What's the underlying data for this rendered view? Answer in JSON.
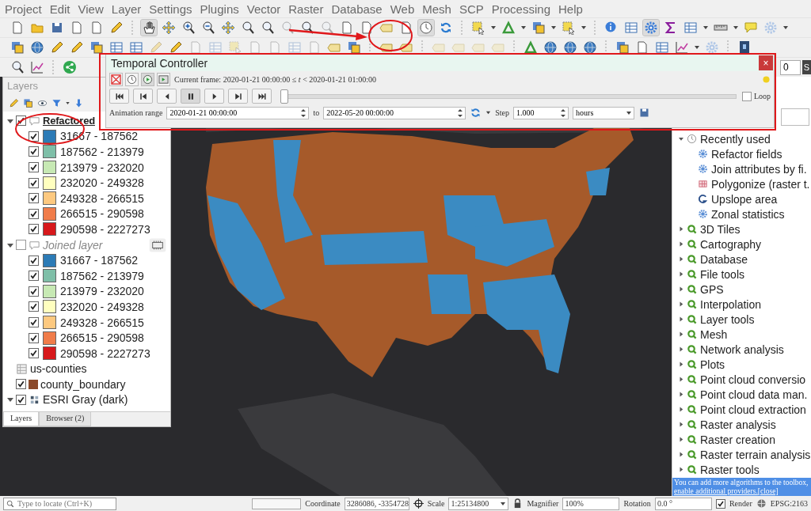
{
  "menu": [
    "Project",
    "Edit",
    "View",
    "Layer",
    "Settings",
    "Plugins",
    "Vector",
    "Raster",
    "Database",
    "Web",
    "Mesh",
    "SCP",
    "Processing",
    "Help"
  ],
  "toolbar_corner": {
    "spin_value": "0",
    "button": "S"
  },
  "temporal_controller": {
    "title": "Temporal Controller",
    "close": "×",
    "modes": [
      {
        "selected": false
      },
      {
        "selected": false
      },
      {
        "selected": true
      },
      {
        "selected": false
      }
    ],
    "current_frame": "Current frame: 2020-01-21 00:00:00 ≤ *t* < 2020-01-21 01:00:00",
    "playback": [
      {
        "selected": false
      },
      {
        "selected": false
      },
      {
        "selected": false
      },
      {
        "selected": true
      },
      {
        "selected": false
      },
      {
        "selected": false
      },
      {
        "selected": false
      }
    ],
    "slider": {
      "level": 0
    },
    "loop": {
      "label": "Loop",
      "checked": false
    },
    "range_label": "Animation range",
    "range_start": "2020-01-21 00:00:00",
    "to_label": "to",
    "range_end": "2022-05-20 00:00:00",
    "step_label": "Step",
    "step": "1.000",
    "unit": "hours"
  },
  "layers_panel": {
    "title": "Layers",
    "layers": [
      {
        "name": "Refactored",
        "kind": "vector",
        "checked": true,
        "expanded": true,
        "current": true,
        "legend": [
          {
            "label": "31667 - 187562",
            "color": "#2c7bb6",
            "checked": true
          },
          {
            "label": "187562 - 213979",
            "color": "#7fbfa8",
            "checked": true
          },
          {
            "label": "213979 - 232020",
            "color": "#c7e9b4",
            "checked": true
          },
          {
            "label": "232020 - 249328",
            "color": "#ffffbf",
            "checked": true
          },
          {
            "label": "249328 - 266515",
            "color": "#fdc980",
            "checked": true
          },
          {
            "label": "266515 - 290598",
            "color": "#f07c4a",
            "checked": true
          },
          {
            "label": "290598 - 2227273",
            "color": "#d7191c",
            "checked": true
          }
        ]
      },
      {
        "name": "Joined layer",
        "kind": "vector",
        "checked": false,
        "expanded": true,
        "current": false,
        "indicator": true,
        "legend": [
          {
            "label": "31667 - 187562",
            "color": "#2c7bb6",
            "checked": true
          },
          {
            "label": "187562 - 213979",
            "color": "#7fbfa8",
            "checked": true
          },
          {
            "label": "213979 - 232020",
            "color": "#c7e9b4",
            "checked": true
          },
          {
            "label": "232020 - 249328",
            "color": "#ffffbf",
            "checked": true
          },
          {
            "label": "249328 - 266515",
            "color": "#fdc980",
            "checked": true
          },
          {
            "label": "266515 - 290598",
            "color": "#f07c4a",
            "checked": true
          },
          {
            "label": "290598 - 2227273",
            "color": "#d7191c",
            "checked": true
          }
        ]
      },
      {
        "name": "us-counties",
        "kind": "table",
        "current": false
      },
      {
        "name": "county_boundary",
        "kind": "fill",
        "color": "#8b4a2b",
        "checked": true,
        "current": false
      },
      {
        "name": "ESRI Gray (dark)",
        "kind": "raster",
        "checked": true,
        "expanded": true,
        "current": false
      }
    ],
    "tabs": [
      {
        "label": "Layers",
        "selected": true
      },
      {
        "label": "Browser (2)",
        "selected": false
      }
    ]
  },
  "processing": {
    "groups": [
      {
        "label": "Recently used",
        "kind": "recent",
        "expanded": true,
        "children": [
          {
            "label": "Refactor fields",
            "kind": "gear"
          },
          {
            "label": "Join attributes by fi.",
            "kind": "gear"
          },
          {
            "label": "Polygonize (raster t.",
            "kind": "grid"
          },
          {
            "label": "Upslope area",
            "kind": "curve"
          },
          {
            "label": "Zonal statistics",
            "kind": "gear"
          }
        ]
      },
      {
        "label": "3D Tiles",
        "kind": "provider",
        "expanded": false
      },
      {
        "label": "Cartography",
        "kind": "provider",
        "expanded": false
      },
      {
        "label": "Database",
        "kind": "provider",
        "expanded": false
      },
      {
        "label": "File tools",
        "kind": "provider",
        "expanded": false
      },
      {
        "label": "GPS",
        "kind": "provider",
        "expanded": false
      },
      {
        "label": "Interpolation",
        "kind": "provider",
        "expanded": false
      },
      {
        "label": "Layer tools",
        "kind": "provider",
        "expanded": false
      },
      {
        "label": "Mesh",
        "kind": "provider",
        "expanded": false
      },
      {
        "label": "Network analysis",
        "kind": "provider",
        "expanded": false
      },
      {
        "label": "Plots",
        "kind": "provider",
        "expanded": false
      },
      {
        "label": "Point cloud conversio",
        "kind": "provider",
        "expanded": false
      },
      {
        "label": "Point cloud data man.",
        "kind": "provider",
        "expanded": false
      },
      {
        "label": "Point cloud extraction",
        "kind": "provider",
        "expanded": false
      },
      {
        "label": "Raster analysis",
        "kind": "provider",
        "expanded": false
      },
      {
        "label": "Raster creation",
        "kind": "provider",
        "expanded": false
      },
      {
        "label": "Raster terrain analysis",
        "kind": "provider",
        "expanded": false
      },
      {
        "label": "Raster tools",
        "kind": "provider",
        "expanded": false
      }
    ],
    "info": {
      "text": "You can add more algorithms to the toolbox, ",
      "link": "enable additional providers.",
      "close": "[close]"
    }
  },
  "status_bar": {
    "locate_placeholder": "Type to locate (Ctrl+K)",
    "progress": {
      "level": 0
    },
    "coordinate_label": "Coordinate",
    "coordinate": "3286086, -3354728",
    "scale_label": "Scale",
    "scale": "1:25134800",
    "magnifier_label": "Magnifier",
    "magnifier": "100%",
    "rotation_label": "Rotation",
    "rotation": "0.0 °",
    "render": {
      "label": "Render",
      "checked": true
    },
    "crs": "EPSG:2163"
  }
}
